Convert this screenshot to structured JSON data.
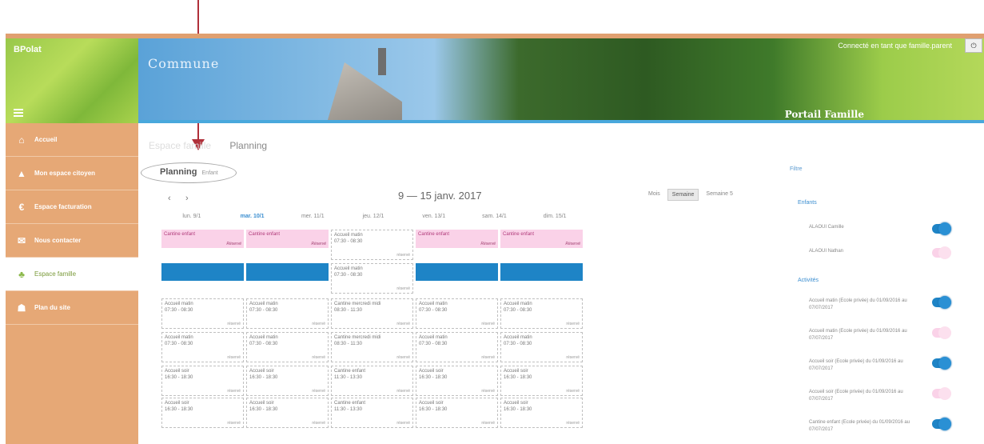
{
  "header": {
    "logo_text": "BPolat",
    "commune_title": "Commune",
    "portail_label": "Portail Famille",
    "user_text": "Connecté en tant que famille.parent"
  },
  "sidebar": {
    "items": [
      {
        "label": "Accueil",
        "icon": "home-icon",
        "glyph": "⌂"
      },
      {
        "label": "Mon espace citoyen",
        "icon": "user-icon",
        "glyph": "▲"
      },
      {
        "label": "Espace facturation",
        "icon": "euro-icon",
        "glyph": "€"
      },
      {
        "label": "Nous contacter",
        "icon": "mail-icon",
        "glyph": "✉"
      },
      {
        "label": "Espace famille",
        "icon": "family-icon",
        "glyph": "♣"
      },
      {
        "label": "Plan du site",
        "icon": "sitemap-icon",
        "glyph": "☗"
      }
    ],
    "active_index": 4
  },
  "breadcrumb": {
    "previous": "Espace famille",
    "current": "Planning"
  },
  "page": {
    "title": "Planning",
    "subtitle": "Enfant"
  },
  "calendar": {
    "date_range": "9 — 15 janv. 2017",
    "views": [
      "Mois",
      "Semaine",
      "Semaine 5"
    ],
    "active_view": 1,
    "days": [
      "lun. 9/1",
      "mar. 10/1",
      "mer. 11/1",
      "jeu. 12/1",
      "ven. 13/1",
      "sam. 14/1",
      "dim. 15/1"
    ],
    "today_index": 1,
    "pink_label": "Cantine enfant",
    "pink_ref": "Réservé",
    "matin_label": "Accueil matin",
    "matin_time": "07:30 - 08:30",
    "soir_label": "Accueil soir",
    "soir_time": "16:30 - 18:30",
    "mercredi_label": "Cantine mercredi midi",
    "mercredi_time": "08:30 - 11:30",
    "cantine_time": "11:30 - 13:30",
    "ref_text": "réservé"
  },
  "right_panel": {
    "filter_label": "Filtre",
    "enfants_label": "Enfants",
    "enfants": [
      {
        "label": "ALAOUI Camille",
        "on": true
      },
      {
        "label": "ALAOUI Nathan",
        "on": false
      }
    ],
    "activites_label": "Activités",
    "activites": [
      {
        "label": "Accueil matin (Ecole privée) du 01/09/2016 au 07/07/2017",
        "on": true
      },
      {
        "label": "Accueil matin (Ecole privée) du 01/09/2016 au 07/07/2017",
        "on": false
      },
      {
        "label": "Accueil soir (Ecole privée) du 01/09/2016 au 07/07/2017",
        "on": true
      },
      {
        "label": "Accueil soir (Ecole privée) du 01/09/2016 au 07/07/2017",
        "on": false
      },
      {
        "label": "Cantine enfant (Ecole privée) du 01/09/2016 au 07/07/2017",
        "on": true
      }
    ]
  },
  "colors": {
    "accent_blue": "#1e84c6",
    "sidebar_orange": "#e6a876",
    "pink_event": "#fad2e8",
    "annotation_red": "#b0303a"
  }
}
